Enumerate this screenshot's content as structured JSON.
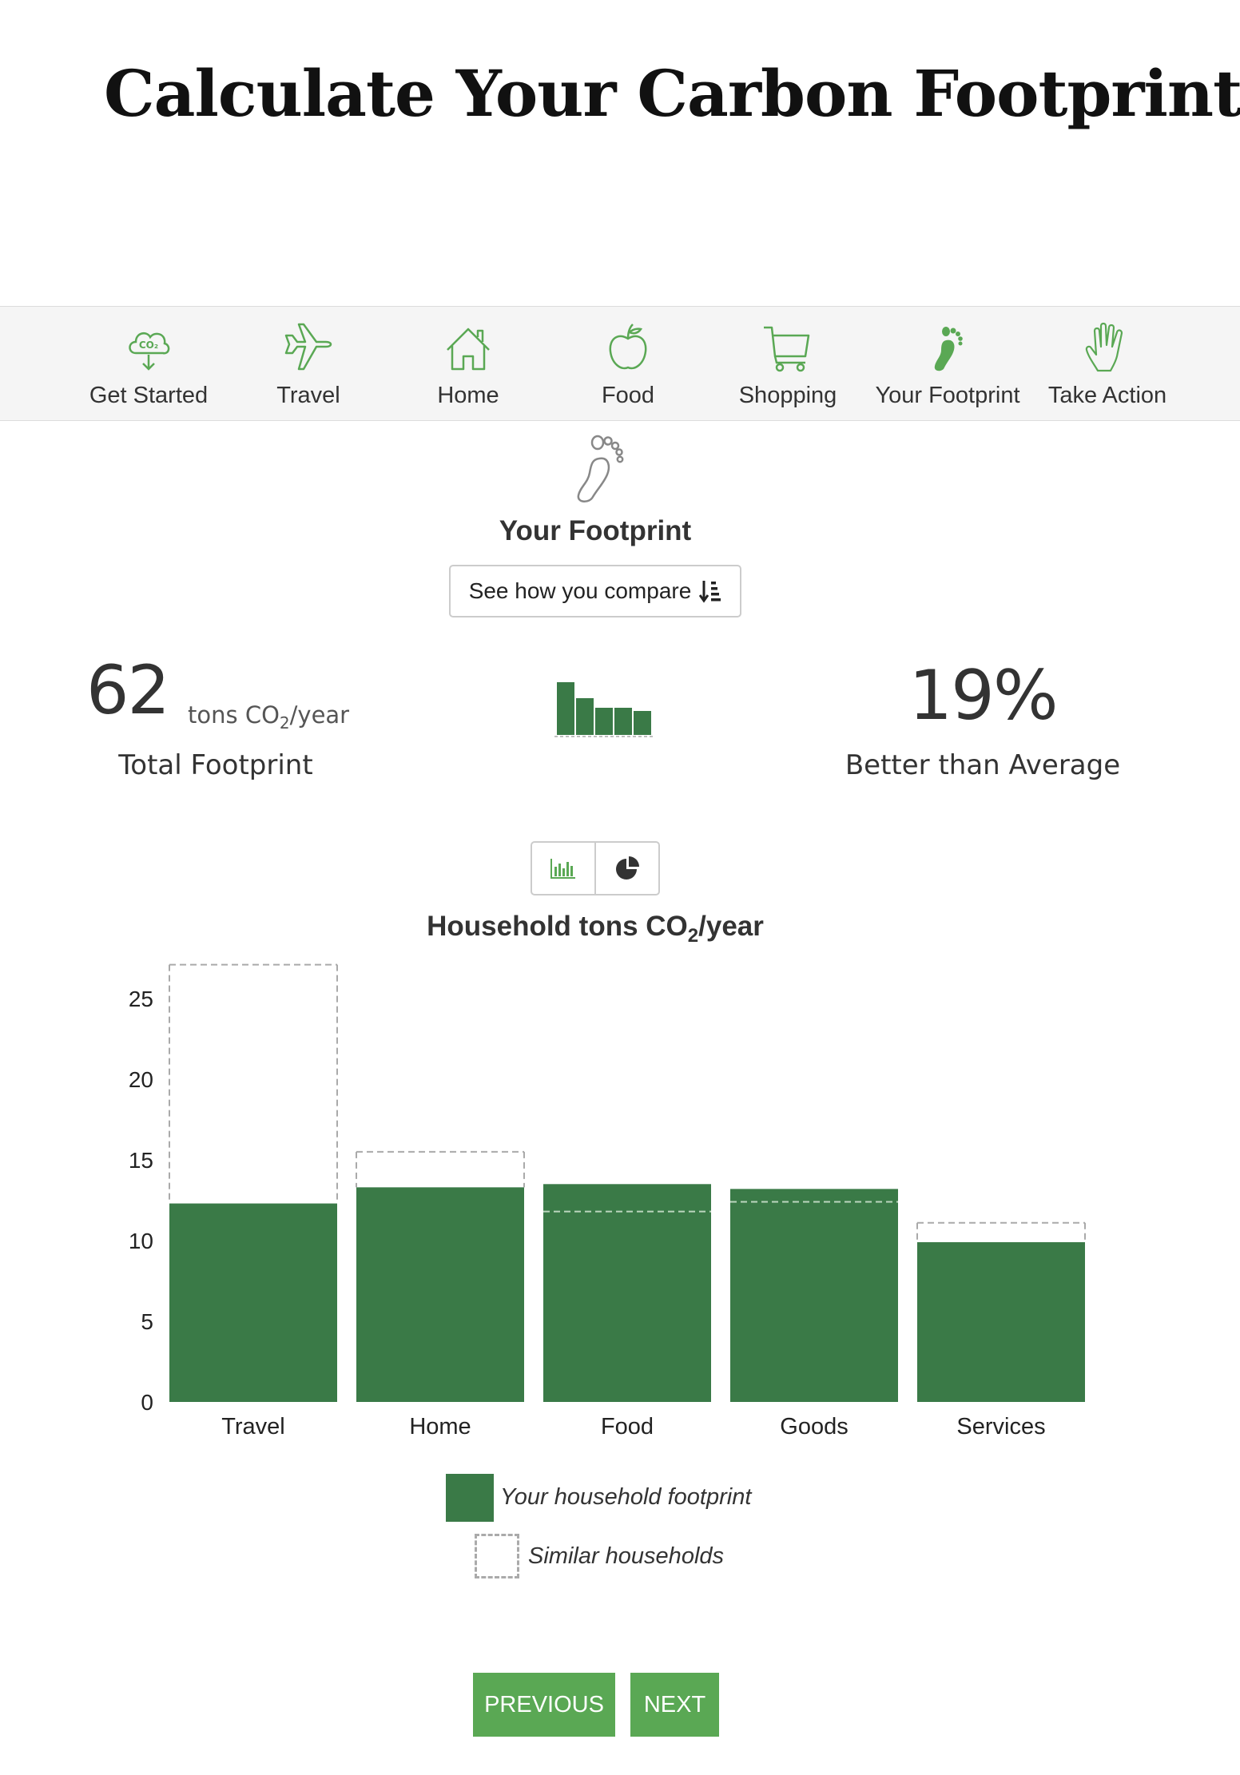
{
  "page": {
    "title": "Calculate Your Carbon Footprint"
  },
  "nav": {
    "items": [
      {
        "label": "Get Started",
        "icon": "co2-cloud-icon"
      },
      {
        "label": "Travel",
        "icon": "airplane-icon"
      },
      {
        "label": "Home",
        "icon": "house-icon"
      },
      {
        "label": "Food",
        "icon": "apple-icon"
      },
      {
        "label": "Shopping",
        "icon": "shopping-cart-icon"
      },
      {
        "label": "Your Footprint",
        "icon": "footprint-icon",
        "active": true
      },
      {
        "label": "Take Action",
        "icon": "hand-icon"
      }
    ]
  },
  "section": {
    "title": "Your Footprint",
    "icon": "footprint-icon",
    "compare_button": "See how you compare"
  },
  "summary": {
    "total_value": "62",
    "total_unit_prefix": "tons CO",
    "total_unit_sub": "2",
    "total_unit_suffix": "/year",
    "total_label": "Total Footprint",
    "better_value": "19%",
    "better_label": "Better than Average"
  },
  "view_toggle": {
    "options": [
      "bar-chart-icon",
      "pie-chart-icon"
    ],
    "selected": "bar-chart-icon"
  },
  "colors": {
    "accent": "#5aa854",
    "bar": "#3a7a47",
    "icon": "#5aa854",
    "dashed": "#aaaaaa"
  },
  "chart_data": {
    "type": "bar",
    "title_prefix": "Household tons CO",
    "title_sub": "2",
    "title_suffix": "/year",
    "categories": [
      "Travel",
      "Home",
      "Food",
      "Goods",
      "Services"
    ],
    "series": [
      {
        "name": "Your household footprint",
        "values": [
          12.3,
          13.3,
          13.5,
          13.2,
          9.9
        ],
        "style": "filled"
      },
      {
        "name": "Similar households",
        "values": [
          27.1,
          15.5,
          11.8,
          12.4,
          11.1
        ],
        "style": "dashed"
      }
    ],
    "yticks": [
      0,
      5,
      10,
      15,
      20,
      25
    ],
    "ylim": [
      0,
      28
    ],
    "legend_position": "bottom"
  },
  "legend": {
    "you": "Your household footprint",
    "similar": "Similar households"
  },
  "pager": {
    "previous": "PREVIOUS",
    "next": "NEXT"
  }
}
